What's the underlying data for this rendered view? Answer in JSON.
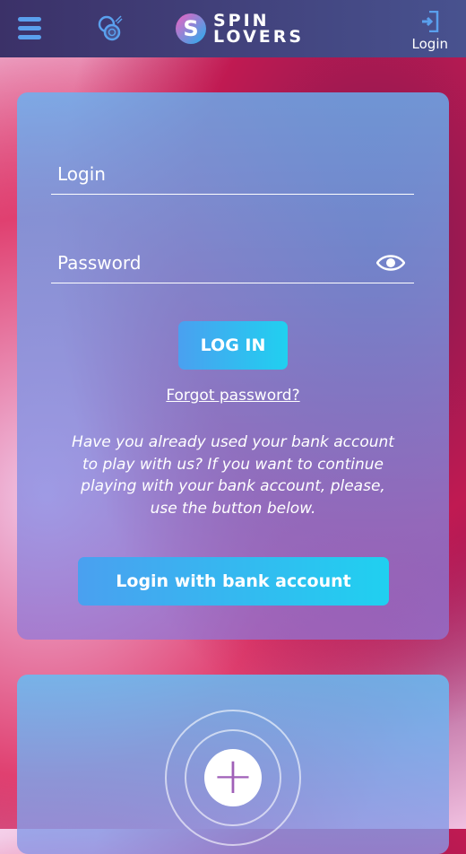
{
  "header": {
    "brand_line1": "SPIN",
    "brand_line2": "LOVERS",
    "login_label": "Login"
  },
  "form": {
    "login_placeholder": "Login",
    "password_placeholder": "Password",
    "login_button": "LOG IN",
    "forgot_link": "Forgot password?",
    "info_text": "Have you already used your bank account to play with us? If you want to continue playing with your bank account, please, use the button below.",
    "bank_button": "Login with bank account"
  },
  "colors": {
    "header": "#3b3168",
    "accent": "#5aa0ee",
    "button_start": "#4aa0f0",
    "button_end": "#20d0f0"
  }
}
